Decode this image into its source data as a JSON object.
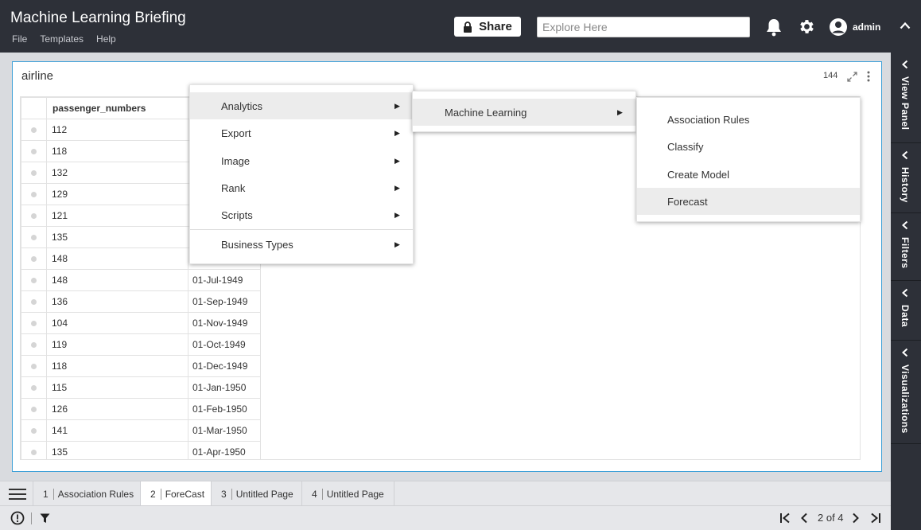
{
  "app": {
    "title": "Machine Learning Briefing",
    "menu": [
      "File",
      "Templates",
      "Help"
    ],
    "share_label": "Share",
    "search_placeholder": "Explore Here",
    "user": "admin"
  },
  "rail": {
    "tabs": [
      "View Panel",
      "History",
      "Filters",
      "Data",
      "Visualizations"
    ]
  },
  "panel": {
    "title": "airline",
    "count": "144",
    "column_header": "passenger_numbers",
    "rows": [
      {
        "value": "112",
        "date": ""
      },
      {
        "value": "118",
        "date": ""
      },
      {
        "value": "132",
        "date": ""
      },
      {
        "value": "129",
        "date": ""
      },
      {
        "value": "121",
        "date": ""
      },
      {
        "value": "135",
        "date": ""
      },
      {
        "value": "148",
        "date": ""
      },
      {
        "value": "148",
        "date": "01-Jul-1949"
      },
      {
        "value": "136",
        "date": "01-Sep-1949"
      },
      {
        "value": "104",
        "date": "01-Nov-1949"
      },
      {
        "value": "119",
        "date": "01-Oct-1949"
      },
      {
        "value": "118",
        "date": "01-Dec-1949"
      },
      {
        "value": "115",
        "date": "01-Jan-1950"
      },
      {
        "value": "126",
        "date": "01-Feb-1950"
      },
      {
        "value": "141",
        "date": "01-Mar-1950"
      },
      {
        "value": "135",
        "date": "01-Apr-1950"
      }
    ]
  },
  "context_menu": {
    "main": [
      "Analytics",
      "Export",
      "Image",
      "Rank",
      "Scripts",
      "Business Types"
    ],
    "analytics": [
      "Machine Learning"
    ],
    "machine_learning": [
      "Association Rules",
      "Classify",
      "Create Model",
      "Forecast"
    ]
  },
  "pages": [
    {
      "num": "1",
      "name": "Association Rules"
    },
    {
      "num": "2",
      "name": "ForeCast"
    },
    {
      "num": "3",
      "name": "Untitled Page"
    },
    {
      "num": "4",
      "name": "Untitled Page"
    }
  ],
  "pager": {
    "label": "2 of 4"
  },
  "colors": {
    "topbar": "#2d3038",
    "panel_border": "#3ea0d8",
    "menu_highlight": "#ececec"
  }
}
